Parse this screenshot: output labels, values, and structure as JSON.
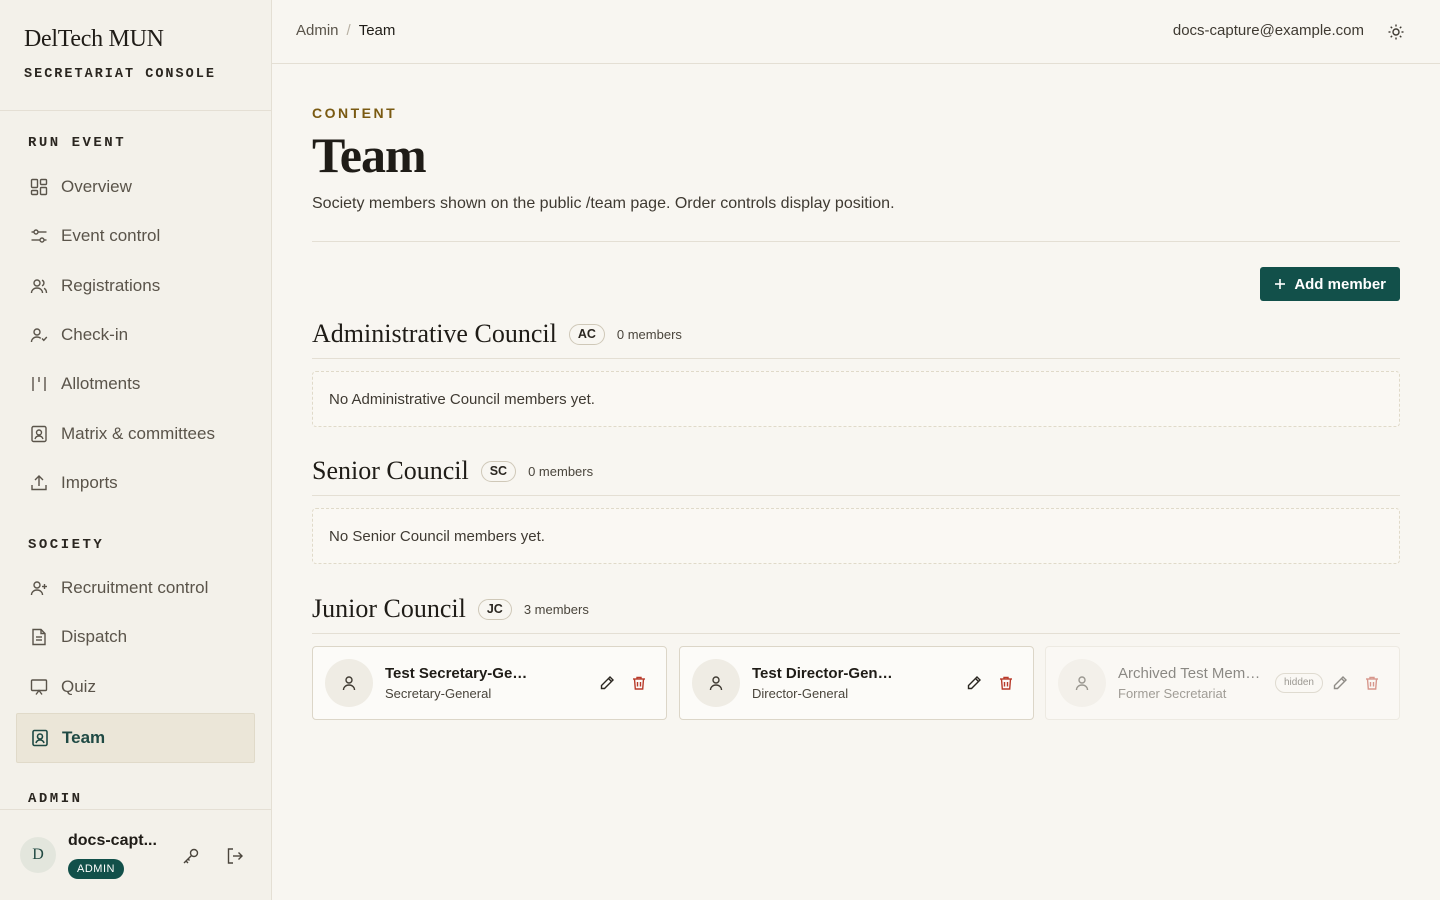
{
  "brand": {
    "title": "DelTech MUN",
    "subtitle": "SECRETARIAT CONSOLE"
  },
  "sidebar": {
    "sections": [
      {
        "label": "RUN EVENT"
      },
      {
        "label": "SOCIETY"
      },
      {
        "label": "ADMIN"
      }
    ],
    "items": [
      {
        "label": "Overview",
        "icon": "grid-icon"
      },
      {
        "label": "Event control",
        "icon": "sliders-icon"
      },
      {
        "label": "Registrations",
        "icon": "users-icon"
      },
      {
        "label": "Check-in",
        "icon": "user-check-icon"
      },
      {
        "label": "Allotments",
        "icon": "bars-icon"
      },
      {
        "label": "Matrix & committees",
        "icon": "portrait-icon"
      },
      {
        "label": "Imports",
        "icon": "upload-icon"
      },
      {
        "label": "Recruitment control",
        "icon": "user-plus-icon"
      },
      {
        "label": "Dispatch",
        "icon": "document-icon"
      },
      {
        "label": "Quiz",
        "icon": "monitor-icon"
      },
      {
        "label": "Team",
        "icon": "portrait-icon",
        "active": true
      }
    ]
  },
  "user": {
    "initial": "D",
    "name": "docs-capt...",
    "role": "ADMIN"
  },
  "header": {
    "breadcrumb": [
      "Admin",
      "Team"
    ],
    "email": "docs-capture@example.com"
  },
  "page": {
    "eyebrow": "CONTENT",
    "title": "Team",
    "description": "Society members shown on the public /team page. Order controls display position.",
    "add_label": "Add member"
  },
  "groups": [
    {
      "title": "Administrative Council",
      "abbr": "AC",
      "count": "0 members",
      "empty": "No Administrative Council members yet."
    },
    {
      "title": "Senior Council",
      "abbr": "SC",
      "count": "0 members",
      "empty": "No Senior Council members yet."
    },
    {
      "title": "Junior Council",
      "abbr": "JC",
      "count": "3 members",
      "members": [
        {
          "name": "Test Secretary-General",
          "role": "Secretary-General"
        },
        {
          "name": "Test Director-General",
          "role": "Director-General"
        },
        {
          "name": "Archived Test Member",
          "role": "Former Secretariat",
          "badge": "hidden"
        }
      ]
    }
  ],
  "colors": {
    "accent": "#12504a",
    "danger": "#b83a2a",
    "eyebrow": "#7a5a12"
  }
}
